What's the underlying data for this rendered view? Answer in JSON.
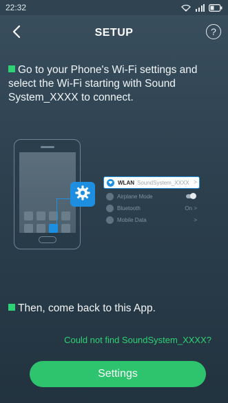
{
  "status_bar": {
    "time": "22:32"
  },
  "header": {
    "title": "SETUP",
    "help_symbol": "?"
  },
  "instructions": {
    "step1": "Go to your Phone's Wi-Fi settings and select the Wi-Fi starting with Sound System_XXXX to connect.",
    "step2": "Then, come back to this App."
  },
  "illustration": {
    "wlan_label": "WLAN",
    "wlan_ssid": "SoundSystem_XXXX",
    "rows": [
      {
        "label": "Airplane Mode",
        "right": ""
      },
      {
        "label": "Bluetooth",
        "right": "On >"
      },
      {
        "label": "Mobile Data",
        "right": ">"
      }
    ],
    "arrow": ">"
  },
  "link_text": "Could not find SoundSystem_XXXX?",
  "settings_button": "Settings",
  "colors": {
    "accent": "#2ed173",
    "button": "#2ec46e",
    "blue": "#1e8fe0"
  }
}
